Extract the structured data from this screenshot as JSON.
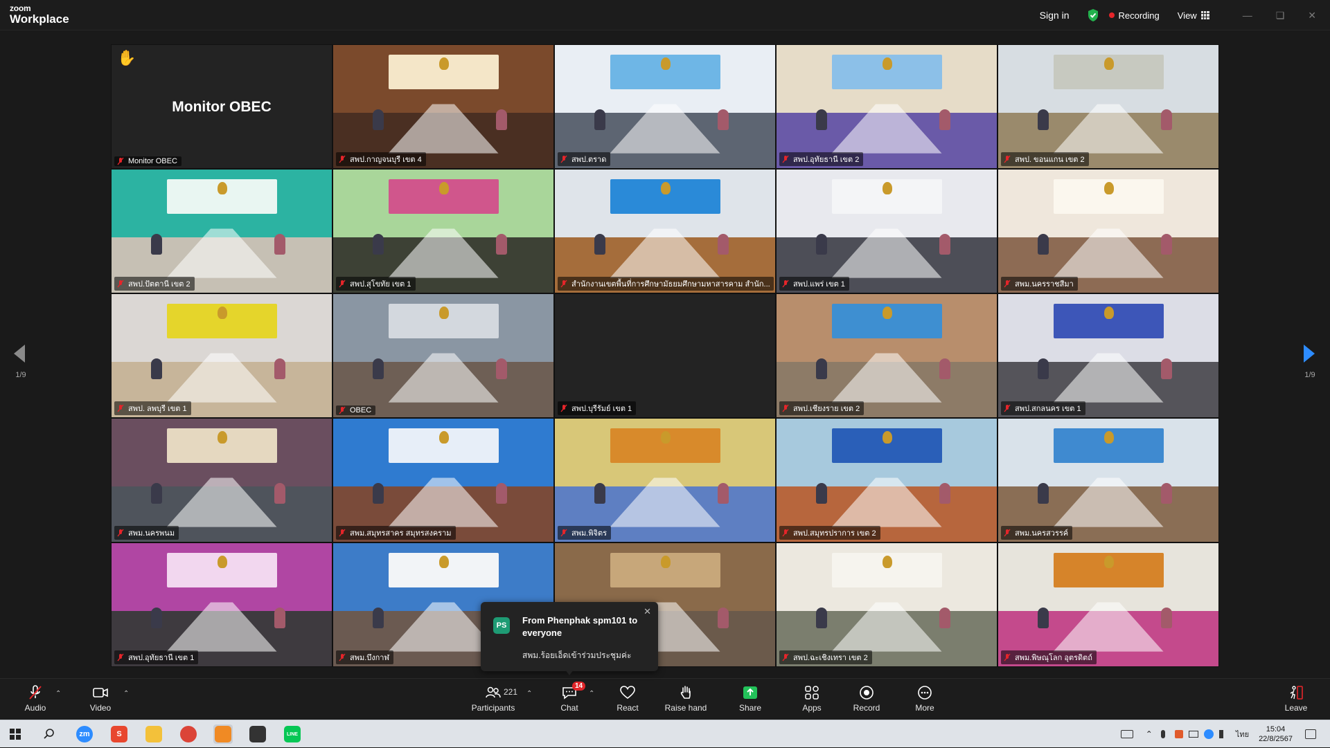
{
  "window": {
    "logo_line1": "zoom",
    "logo_line2": "Workplace",
    "sign_in": "Sign in",
    "recording": "Recording",
    "view": "View"
  },
  "stage": {
    "page_left": "1/9",
    "page_right": "1/9"
  },
  "tiles": [
    {
      "label": "Monitor OBEC",
      "center": "Monitor OBEC",
      "hand": true,
      "style": "blank"
    },
    {
      "label": "สพป.กาญจนบุรี เขต 4",
      "wall": "#7b4a2c",
      "floor": "#4a2f22",
      "banner": "#f4e6c8"
    },
    {
      "label": "สพป.ตราด",
      "wall": "#e9eef4",
      "floor": "#5d6572",
      "banner": "#6eb6e6"
    },
    {
      "label": "สพป.อุทัยธานี เขต 2",
      "wall": "#e6dcc8",
      "floor": "#6a5aa8",
      "banner": "#8cc0e8"
    },
    {
      "label": "สพป. ขอนแกน เขต 2",
      "wall": "#d7dde2",
      "floor": "#9a8a6c",
      "banner": "#c7c9c0"
    },
    {
      "label": "สพป.ปัตตานี เขต 2",
      "wall": "#2cb3a2",
      "floor": "#c6c0b4",
      "banner": "#e9f6f2"
    },
    {
      "label": "สพป.สุโขทัย เขต 1",
      "wall": "#a9d69a",
      "floor": "#3d4135",
      "banner": "#d0568c"
    },
    {
      "label": "สำนักงานเขตพื้นที่การศึกษามัธยมศึกษามหาสารคาม สำนัก...",
      "wall": "#dfe4ea",
      "floor": "#a56d3b",
      "banner": "#2a8ad8"
    },
    {
      "label": "สพป.แพร่ เขต 1",
      "wall": "#e8e9ee",
      "floor": "#4d4e57",
      "banner": "#f4f5f7"
    },
    {
      "label": "สพม.นครราชสีมา",
      "wall": "#efe7dc",
      "floor": "#8d6b54",
      "banner": "#fbf7ee"
    },
    {
      "label": "สพป. ลพบุรี เขต 1",
      "wall": "#dbd7d4",
      "floor": "#c7b59a",
      "banner": "#e5d52b"
    },
    {
      "label": "OBEC",
      "wall": "#8a96a3",
      "floor": "#6e5f55",
      "banner": "#d3d8de"
    },
    {
      "label": "สพป.บุรีรัมย์ เขต 1",
      "style": "dark"
    },
    {
      "label": "สพป.เชียงราย เขต 2",
      "wall": "#b88e6c",
      "floor": "#8d7b67",
      "banner": "#3e8fd1"
    },
    {
      "label": "สพป.สกลนคร เขต 1",
      "wall": "#dcdde6",
      "floor": "#55545a",
      "banner": "#3d56b8"
    },
    {
      "label": "สพม.นครพนม",
      "wall": "#6a4e5f",
      "floor": "#4f545c",
      "banner": "#e5d8c0"
    },
    {
      "label": "สพม.สมุทรสาคร สมุทรสงคราม",
      "wall": "#2f7bd0",
      "floor": "#7a4b3a",
      "banner": "#e7eef8"
    },
    {
      "label": "สพม.พิจิตร",
      "wall": "#d8c778",
      "floor": "#5e7fc2",
      "banner": "#d88a2b"
    },
    {
      "label": "สพป.สมุทรปราการ เขต 2",
      "wall": "#a7c9dd",
      "floor": "#b7663d",
      "banner": "#2a5fb8"
    },
    {
      "label": "สพม.นครสวรรค์",
      "wall": "#d9e2ea",
      "floor": "#8a6e55",
      "banner": "#3f8ad0"
    },
    {
      "label": "สพป.อุทัยธานี เขต 1",
      "wall": "#b046a3",
      "floor": "#3e3a3f",
      "banner": "#f2d7ef"
    },
    {
      "label": "สพม.บึงกาฬ",
      "wall": "#3d7cc8",
      "floor": "#6b5a51",
      "banner": "#f2f4f7"
    },
    {
      "label": "",
      "wall": "#8a6a4a",
      "floor": "#6b5a4b",
      "banner": "#c7a77a"
    },
    {
      "label": "สพป.ฉะเชิงเทรา เขต 2",
      "wall": "#ece8df",
      "floor": "#7b7e6e",
      "banner": "#f6f4ee"
    },
    {
      "label": "สพม.พิษณุโลก อุตรดิตถ์",
      "wall": "#e7e4dc",
      "floor": "#c44a8c",
      "banner": "#d6842a"
    }
  ],
  "toast": {
    "avatar": "PS",
    "from": "From Phenphak spm101 to everyone",
    "message": "สพม.ร้อยเอ็ดเข้าร่วมประชุมค่ะ"
  },
  "toolbar": {
    "audio": "Audio",
    "video": "Video",
    "participants": "Participants",
    "participants_count": "221",
    "chat": "Chat",
    "chat_badge": "14",
    "react": "React",
    "raise_hand": "Raise hand",
    "share": "Share",
    "apps": "Apps",
    "record": "Record",
    "more": "More",
    "leave": "Leave"
  },
  "taskbar": {
    "apps": [
      {
        "name": "zoom-app",
        "text": "zm",
        "color": "#2d8cff"
      },
      {
        "name": "s-app",
        "text": "S",
        "color": "#e8472e"
      },
      {
        "name": "file-explorer",
        "text": "",
        "color": "#f3c13a"
      },
      {
        "name": "chrome",
        "text": "",
        "color": "#db4437"
      },
      {
        "name": "orange-app",
        "text": "",
        "color": "#f08a24"
      },
      {
        "name": "dark-app",
        "text": "",
        "color": "#333333"
      },
      {
        "name": "line-app",
        "text": "LINE",
        "color": "#06c755"
      }
    ],
    "lang": "ไทย",
    "time": "15:04",
    "date": "22/8/2567"
  }
}
